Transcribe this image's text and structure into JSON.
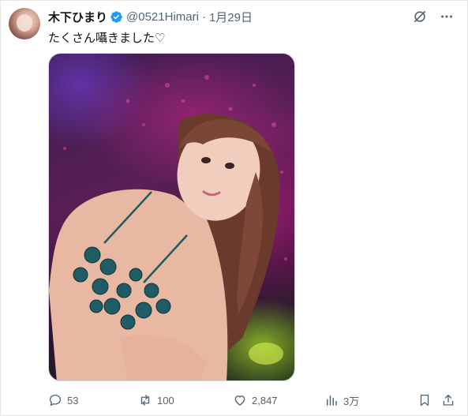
{
  "post": {
    "author_name": "木下ひまり",
    "handle": "@0521Himari",
    "separator": "·",
    "date": "1月29日",
    "text": "たくさん囁きました♡"
  },
  "icons": {
    "verified": "verified-badge-icon",
    "grok": "grok-icon",
    "more": "more-icon",
    "reply": "reply-icon",
    "repost": "repost-icon",
    "like": "like-icon",
    "views": "views-icon",
    "bookmark": "bookmark-icon",
    "share": "share-icon"
  },
  "actions": {
    "replies": "53",
    "reposts": "100",
    "likes": "2,847",
    "views": "3万"
  },
  "colors": {
    "text": "#0f1419",
    "secondary": "#536471",
    "verified": "#1d9bf0"
  }
}
